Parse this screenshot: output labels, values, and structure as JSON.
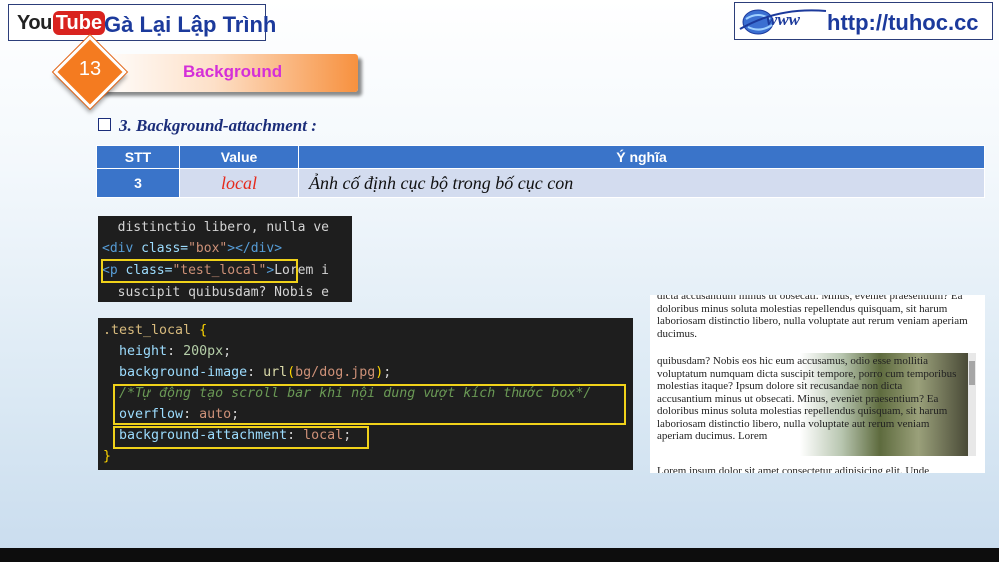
{
  "header": {
    "youtube_you": "You",
    "youtube_tube": "Tube",
    "channel_name": "Gà Lại Lập Trình",
    "site_url": "http://tuhoc.cc"
  },
  "lesson": {
    "number": "13",
    "title": "Background"
  },
  "section_title": "3. Background-attachment :",
  "table": {
    "headers": [
      "STT",
      "Value",
      "Ý nghĩa"
    ],
    "rows": [
      {
        "stt": "3",
        "value": "local",
        "meaning": "Ảnh cố định cục bộ trong bố cục con"
      }
    ]
  },
  "code_html": {
    "line1": "  distinctio libero, nulla ve",
    "line2_tag_open": "<div ",
    "line2_attr": "class=",
    "line2_str": "\"box\"",
    "line2_tag_close": "></div>",
    "line3_tag_open": "<p ",
    "line3_attr": "class=",
    "line3_str": "\"test_local\"",
    "line3_tag_close": ">",
    "line3_text": "Lorem i",
    "line4": "  suscipit quibusdam? Nobis e"
  },
  "code_css": {
    "selector": ".test_local",
    "open_brace": " {",
    "height_prop": "height",
    "height_val": "200px",
    "bgimg_prop": "background-image",
    "bgimg_fn": "url",
    "bgimg_arg": "bg/dog.jpg",
    "comment": "/*Tự động tạo scroll bar khi nội dung vượt kích thước box*/",
    "overflow_prop": "overflow",
    "overflow_val": "auto",
    "attach_prop": "background-attachment",
    "attach_val": "local",
    "close_brace": "}"
  },
  "preview": {
    "top_text": "dicta accusantium minus ut obsecati. Minus, eveniet praesentium? Ea doloribus minus soluta molestias repellendus quisquam, sit harum laboriosam distinctio libero, nulla voluptate aut rerum veniam aperiam ducimus.",
    "box_text": "quibusdam? Nobis eos hic eum accusamus, odio esse mollitia voluptatum numquam dicta suscipit tempore, porro cum temporibus molestias itaque? Ipsum dolore sit recusandae non dicta accusantium minus ut obsecati. Minus, eveniet praesentium? Ea doloribus minus soluta molestias repellendus quisquam, sit harum laboriosam distinctio libero, nulla voluptate aut rerum veniam aperiam ducimus. Lorem",
    "bottom_text": "Lorem ipsum dolor sit amet consectetur adipisicing elit. Unde"
  },
  "colors": {
    "title_blue": "#1c3a9c",
    "table_header": "#3a74c9",
    "banner_orange": "#f47b20",
    "highlight_yellow": "#f0d21a"
  },
  "icons": [
    "youtube-logo",
    "www-globe-icon",
    "checkbox-icon"
  ]
}
